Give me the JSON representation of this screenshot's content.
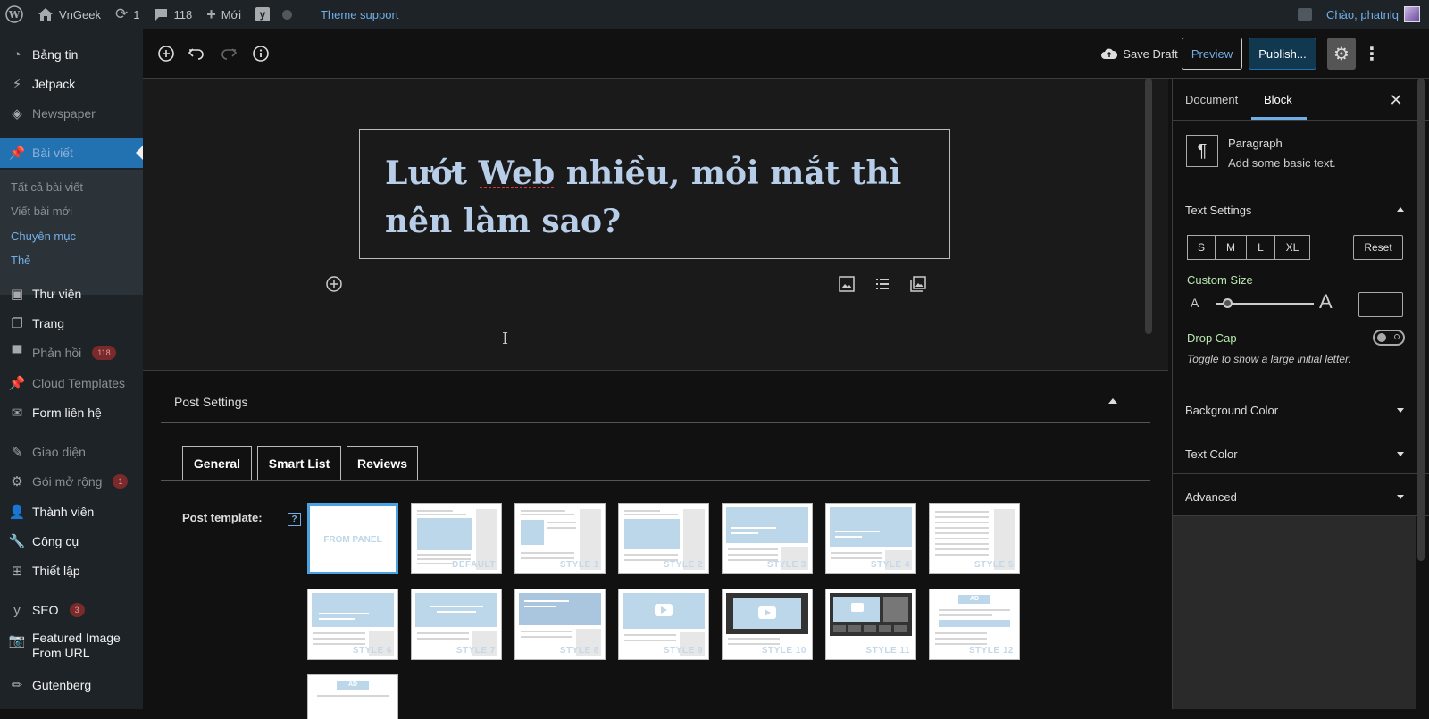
{
  "adminbar": {
    "site_name": "VnGeek",
    "updates_count": "1",
    "comments_count": "118",
    "new_label": "Mới",
    "theme_support": "Theme support",
    "greeting": "Chào, phatnlq"
  },
  "sidebar": {
    "items": [
      {
        "label": "Bảng tin"
      },
      {
        "label": "Jetpack"
      },
      {
        "label": "Newspaper"
      },
      {
        "label": "Bài viết"
      },
      {
        "label": "Thư viện"
      },
      {
        "label": "Trang"
      },
      {
        "label": "Phản hồi",
        "badge": "118"
      },
      {
        "label": "Cloud Templates"
      },
      {
        "label": "Form liên hệ"
      },
      {
        "label": "Giao diện"
      },
      {
        "label": "Gói mở rộng",
        "badge": "1"
      },
      {
        "label": "Thành viên"
      },
      {
        "label": "Công cụ"
      },
      {
        "label": "Thiết lập"
      },
      {
        "label": "SEO",
        "badge": "3"
      },
      {
        "label": "Featured Image From URL"
      },
      {
        "label": "Gutenberg"
      }
    ],
    "submenu": [
      "Tất cả bài viết",
      "Viết bài mới",
      "Chuyên mục",
      "Thẻ"
    ]
  },
  "toolbar": {
    "save_draft": "Save Draft",
    "preview": "Preview",
    "publish": "Publish..."
  },
  "editor": {
    "title": "Lướt Web nhiều, mỏi mắt thì nên làm sao?"
  },
  "post_settings": {
    "heading": "Post Settings",
    "tabs": [
      "General",
      "Smart List",
      "Reviews"
    ],
    "template_label": "Post template:",
    "help": "?",
    "templates": [
      "FROM PANEL",
      "DEFAULT",
      "STYLE 1",
      "STYLE 2",
      "STYLE 3",
      "STYLE 4",
      "STYLE 5",
      "STYLE 6",
      "STYLE 7",
      "STYLE 8",
      "STYLE 9",
      "STYLE 10",
      "STYLE 11",
      "STYLE 12"
    ],
    "ad_label": "AD"
  },
  "right_sidebar": {
    "tabs": [
      "Document",
      "Block"
    ],
    "block_name": "Paragraph",
    "block_desc": "Add some basic text.",
    "text_settings": "Text Settings",
    "sizes": [
      "S",
      "M",
      "L",
      "XL"
    ],
    "reset": "Reset",
    "custom_size": "Custom Size",
    "size_small_glyph": "A",
    "size_large_glyph": "A",
    "drop_cap": "Drop Cap",
    "drop_cap_help": "Toggle to show a large initial letter.",
    "background_color": "Background Color",
    "text_color": "Text Color",
    "advanced": "Advanced"
  }
}
